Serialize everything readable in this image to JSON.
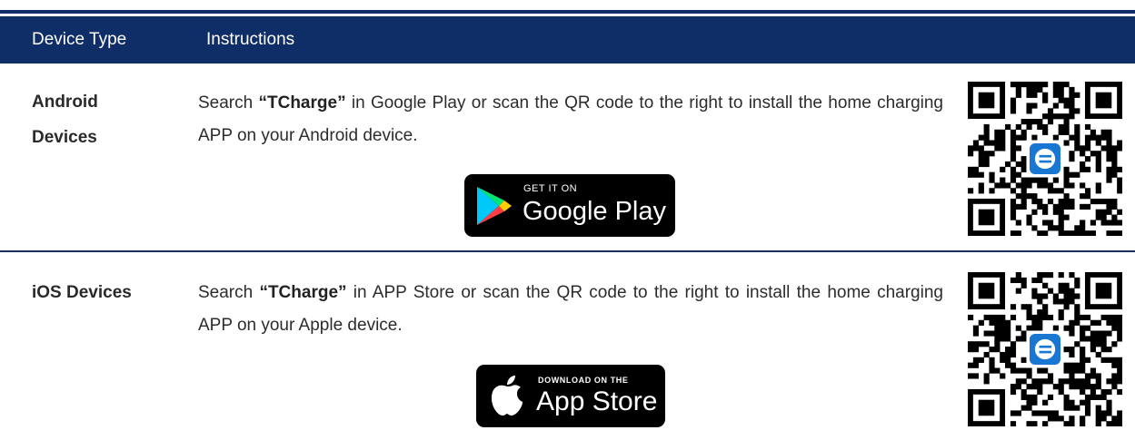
{
  "header": {
    "col1": "Device Type",
    "col2": "Instructions"
  },
  "rows": [
    {
      "device_line1": "Android",
      "device_line2": "Devices",
      "instr_prefix": "Search ",
      "keyword": "“TCharge”",
      "instr_suffix": " in Google Play or scan the QR code to the right to install the home charging APP on your Android device.",
      "badge_small": "GET IT ON",
      "badge_large": "Google Play",
      "badge_icon": "google-play-icon",
      "qr_icon": "qr-code-icon"
    },
    {
      "device_line1": "iOS Devices",
      "instr_prefix": "Search ",
      "keyword": "“TCharge”",
      "instr_suffix": " in APP Store or scan the QR code to the right to install the home charging APP on your Apple device.",
      "badge_small": "DOWNLOAD ON THE",
      "badge_large": "App Store",
      "badge_icon": "apple-icon",
      "qr_icon": "qr-code-icon"
    }
  ],
  "colors": {
    "header_bg": "#0f2d67",
    "qr_center": "#1976d2"
  }
}
